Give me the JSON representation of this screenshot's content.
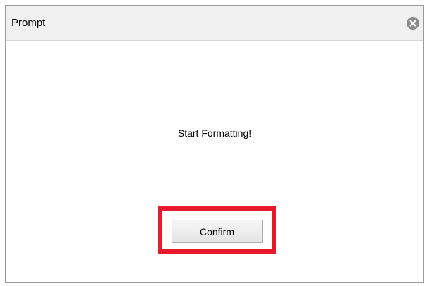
{
  "dialog": {
    "title": "Prompt",
    "message": "Start Formatting!",
    "confirm_label": "Confirm",
    "close_icon": "close-icon",
    "highlight_color": "#e8192c"
  }
}
